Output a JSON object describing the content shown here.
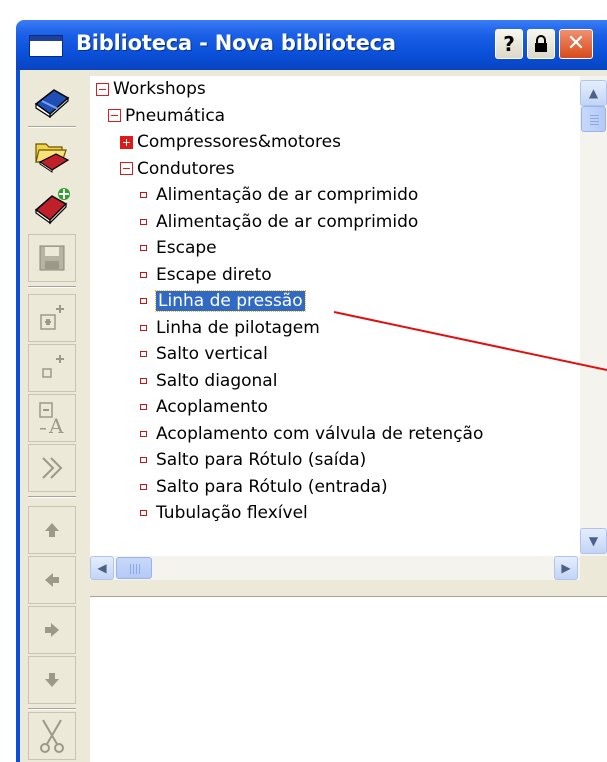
{
  "window": {
    "title": "Biblioteca - Nova biblioteca",
    "help_label": "?",
    "close_label": "✕"
  },
  "toolbar": {
    "buttons": [
      {
        "name": "library-book-icon",
        "enabled": true
      },
      {
        "name": "open-folder-icon",
        "enabled": true
      },
      {
        "name": "new-book-icon",
        "enabled": true
      },
      {
        "name": "save-icon",
        "enabled": false
      },
      {
        "name": "add-group-icon",
        "enabled": false
      },
      {
        "name": "add-item-icon",
        "enabled": false
      },
      {
        "name": "rename-icon",
        "enabled": false
      },
      {
        "name": "expand-icon",
        "enabled": false
      },
      {
        "name": "move-up-icon",
        "enabled": false
      },
      {
        "name": "move-left-icon",
        "enabled": false
      },
      {
        "name": "move-right-icon",
        "enabled": false
      },
      {
        "name": "move-down-icon",
        "enabled": false
      },
      {
        "name": "cut-icon",
        "enabled": false
      }
    ]
  },
  "tree": {
    "nodes": [
      {
        "label": "Workshops",
        "level": 0,
        "type": "expanded"
      },
      {
        "label": "Pneumática",
        "level": 1,
        "type": "expanded"
      },
      {
        "label": "Compressores&motores",
        "level": 2,
        "type": "collapsed"
      },
      {
        "label": "Condutores",
        "level": 2,
        "type": "expanded"
      },
      {
        "label": "Alimentação de ar comprimido",
        "level": 3,
        "type": "leaf"
      },
      {
        "label": "Alimentação de ar comprimido",
        "level": 3,
        "type": "leaf"
      },
      {
        "label": "Escape",
        "level": 3,
        "type": "leaf"
      },
      {
        "label": "Escape direto",
        "level": 3,
        "type": "leaf"
      },
      {
        "label": "Linha de pressão",
        "level": 3,
        "type": "leaf",
        "selected": true
      },
      {
        "label": "Linha de pilotagem",
        "level": 3,
        "type": "leaf"
      },
      {
        "label": "Salto vertical",
        "level": 3,
        "type": "leaf"
      },
      {
        "label": "Salto diagonal",
        "level": 3,
        "type": "leaf"
      },
      {
        "label": "Acoplamento",
        "level": 3,
        "type": "leaf"
      },
      {
        "label": "Acoplamento com válvula de retenção",
        "level": 3,
        "type": "leaf"
      },
      {
        "label": "Salto para Rótulo (saída)",
        "level": 3,
        "type": "leaf"
      },
      {
        "label": "Salto para Rótulo (entrada)",
        "level": 3,
        "type": "leaf"
      },
      {
        "label": "Tubulação flexível",
        "level": 3,
        "type": "leaf"
      }
    ]
  },
  "colors": {
    "titlebar": "#0a4fd8",
    "selection": "#316ac5",
    "expander": "#d42020",
    "callout_line": "#e01010"
  }
}
